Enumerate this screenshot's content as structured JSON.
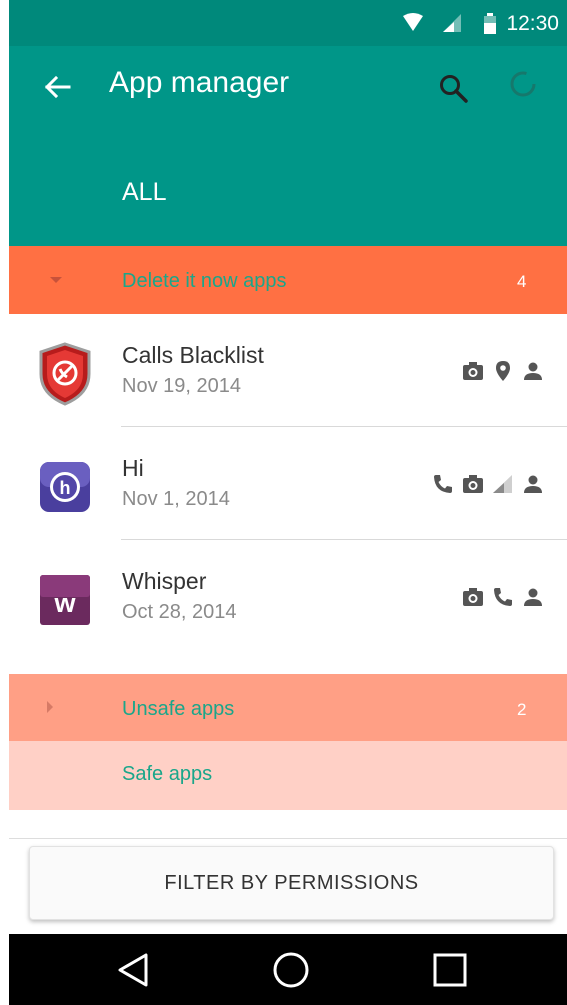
{
  "status_bar": {
    "time": "12:30"
  },
  "app_bar": {
    "title": "App manager",
    "tab": "ALL"
  },
  "sections": {
    "delete": {
      "label": "Delete it now apps",
      "count": "4"
    },
    "unsafe": {
      "label": "Unsafe apps",
      "count": "2"
    },
    "safe": {
      "label": "Safe apps"
    }
  },
  "apps": [
    {
      "name": "Calls Blacklist",
      "date": "Nov 19, 2014",
      "permissions": [
        "camera-icon",
        "location-icon",
        "contacts-icon"
      ]
    },
    {
      "name": "Hi",
      "date": "Nov 1, 2014",
      "permissions": [
        "phone-icon",
        "camera-icon",
        "signal-icon",
        "contacts-icon"
      ]
    },
    {
      "name": "Whisper",
      "date": "Oct 28, 2014",
      "permissions": [
        "camera-icon",
        "phone-icon",
        "contacts-icon"
      ]
    }
  ],
  "filter_button": {
    "label": "FILTER BY PERMISSIONS"
  },
  "colors": {
    "primary": "#009688",
    "status_bar": "#00897b",
    "delete_section": "#ff7043",
    "unsafe_section": "#ff9f85",
    "safe_section": "#ffd0c6",
    "section_text": "#1aa68a"
  }
}
